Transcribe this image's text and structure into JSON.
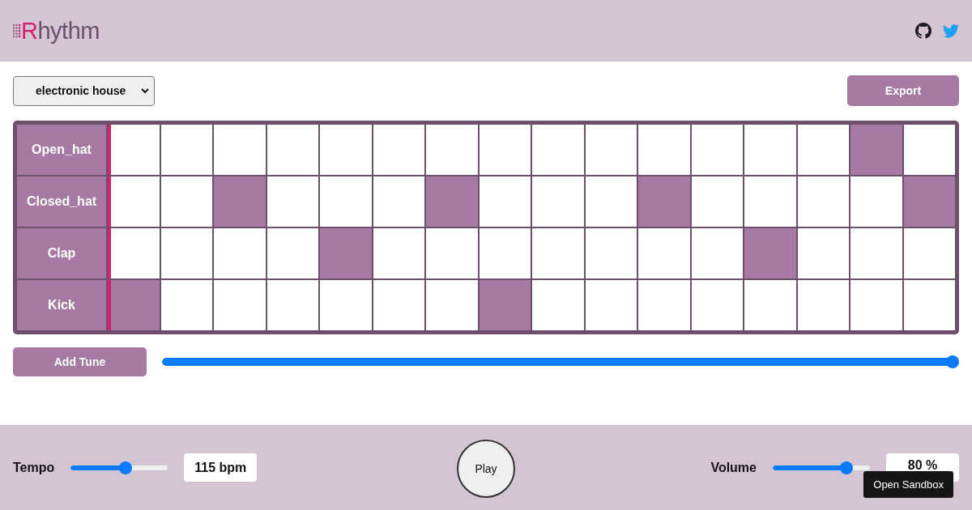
{
  "header": {
    "logo": "Rhythm"
  },
  "toolbar": {
    "preset": "electronic house",
    "export_button": "Export"
  },
  "sequencer": {
    "columns": [
      {
        "current": true
      },
      {
        "current": false
      },
      {
        "current": false
      },
      {
        "current": false
      },
      {
        "current": false
      },
      {
        "current": false
      },
      {
        "current": false
      },
      {
        "current": false
      },
      {
        "current": false
      },
      {
        "current": false
      },
      {
        "current": false
      },
      {
        "current": false
      },
      {
        "current": false
      },
      {
        "current": false
      },
      {
        "current": false
      },
      {
        "current": false
      }
    ],
    "rows": [
      {
        "name": "Open_hat",
        "steps": [
          false,
          false,
          false,
          false,
          false,
          false,
          false,
          false,
          false,
          false,
          false,
          false,
          false,
          false,
          true,
          false
        ]
      },
      {
        "name": "Closed_hat",
        "steps": [
          false,
          false,
          true,
          false,
          false,
          false,
          true,
          false,
          false,
          false,
          true,
          false,
          false,
          false,
          false,
          true
        ]
      },
      {
        "name": "Clap",
        "steps": [
          false,
          false,
          false,
          false,
          true,
          false,
          false,
          false,
          false,
          false,
          false,
          false,
          true,
          false,
          false,
          false
        ]
      },
      {
        "name": "Kick",
        "steps": [
          true,
          false,
          false,
          false,
          false,
          false,
          false,
          true,
          false,
          false,
          false,
          false,
          false,
          false,
          false,
          false
        ]
      }
    ]
  },
  "add_tune": {
    "label": "Add Tune",
    "level": 1.0
  },
  "footer": {
    "tempo": {
      "label": "Tempo",
      "level": 0.57,
      "reading": "115 bpm"
    },
    "play_button": "Play",
    "volume": {
      "label": "Volume",
      "level": 0.78,
      "reading": "80 %"
    },
    "sandbox_button": "Open Sandbox"
  }
}
